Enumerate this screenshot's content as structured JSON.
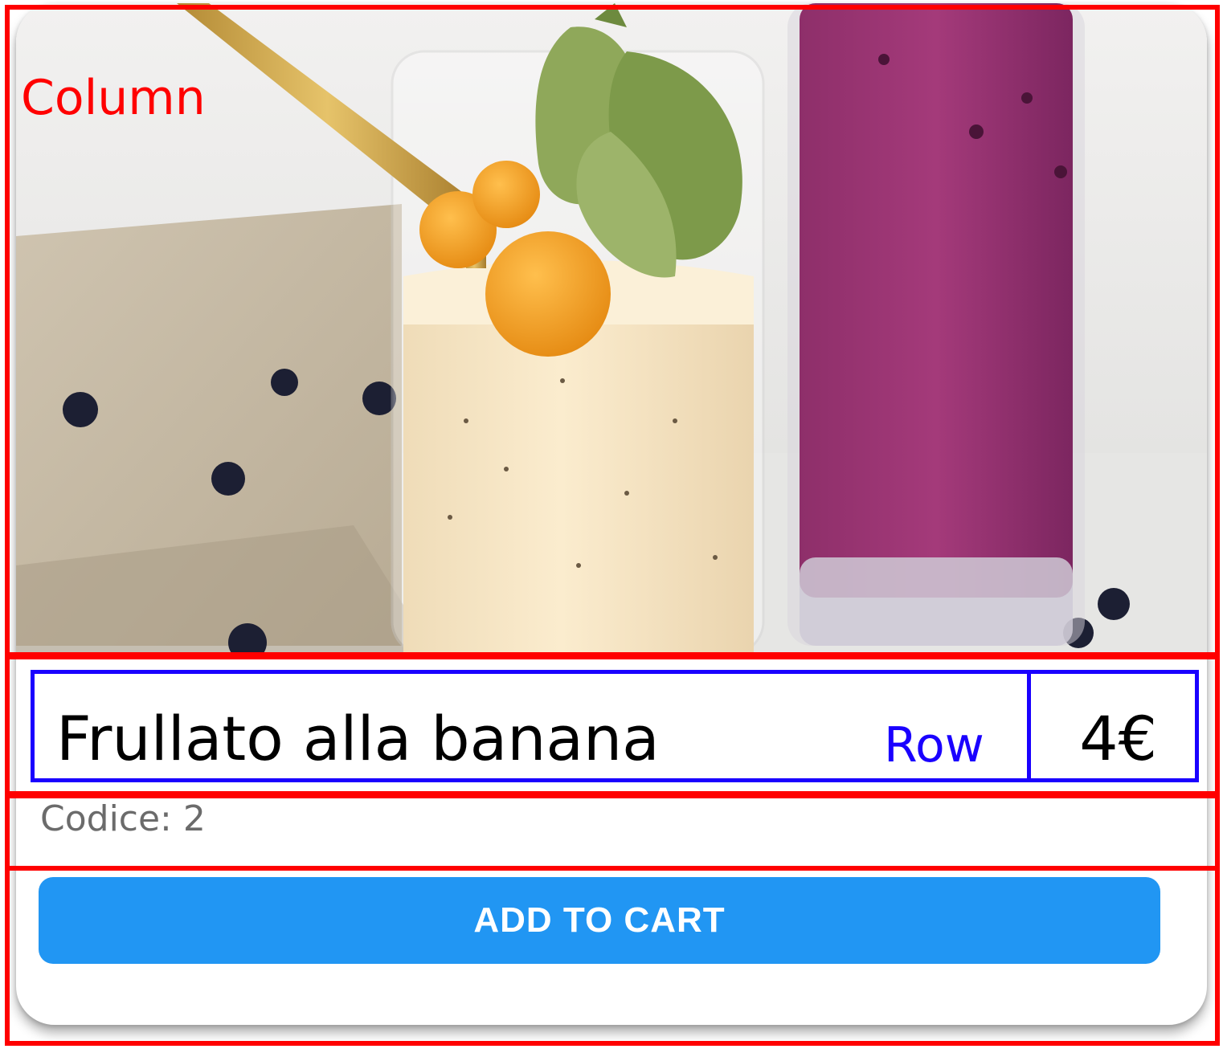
{
  "product": {
    "name": "Frullato alla banana",
    "price": "4€",
    "code": "Codice: 2",
    "image_icon": "smoothie-photo"
  },
  "actions": {
    "add_to_cart_label": "ADD TO CART"
  },
  "annotations": {
    "column_label": "Column",
    "row_label": "Row"
  },
  "colors": {
    "button": "#2196f3",
    "button_text": "#ffffff",
    "code_text": "#6b6b6b",
    "annotation_column": "#ff0000",
    "annotation_row": "#1a00ff"
  }
}
